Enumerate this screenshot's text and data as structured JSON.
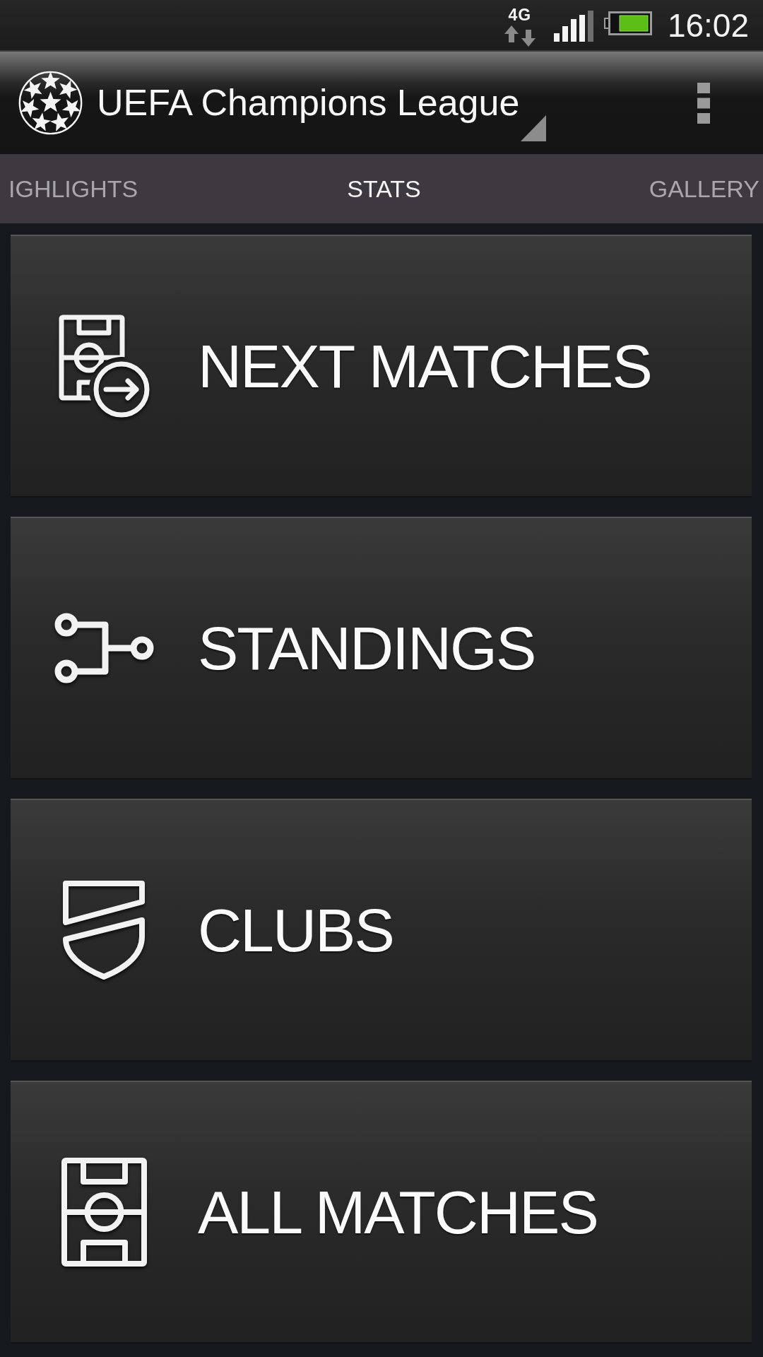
{
  "status_bar": {
    "network": "4G",
    "time": "16:02"
  },
  "app_bar": {
    "title": "UEFA Champions League"
  },
  "tabs": [
    {
      "label": "IGHLIGHTS",
      "selected": false
    },
    {
      "label": "STATS",
      "selected": true
    },
    {
      "label": "GALLERY",
      "selected": false
    }
  ],
  "menu_items": [
    {
      "kind": "next-matches",
      "label": "NEXT MATCHES"
    },
    {
      "kind": "standings",
      "label": "STANDINGS"
    },
    {
      "kind": "clubs",
      "label": "CLUBS"
    },
    {
      "kind": "all-matches",
      "label": "ALL MATCHES"
    }
  ]
}
